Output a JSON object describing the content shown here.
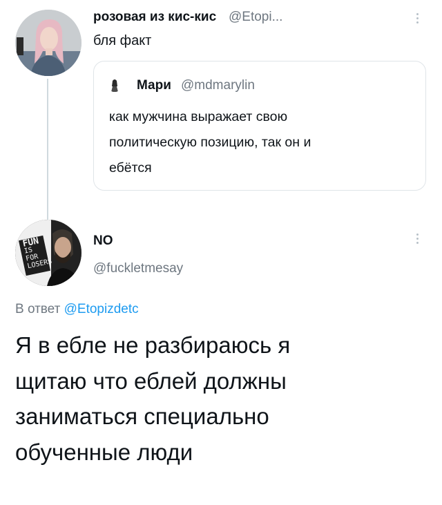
{
  "tweet1": {
    "display_name": "розовая из кис-кис",
    "handle": "@Etopi...",
    "text": "бля факт",
    "more_icon": "ellipsis-vertical-icon"
  },
  "quoted": {
    "display_name": "Мари",
    "handle": "@mdmarylin",
    "text_lines": [
      "как мужчина выражает свою",
      "политическую позицию, так он и",
      "ебётся"
    ]
  },
  "tweet2": {
    "display_name": "NO",
    "handle": "@fuckletmesay",
    "avatar_text": [
      "FUN",
      "IS FOR",
      "LOSERS"
    ],
    "reply_prefix": "В ответ",
    "reply_handle": "@Etopizdetc",
    "text_lines": [
      "Я в ебле не разбираюсь я",
      "щитаю что еблей должны",
      "заниматься специально",
      "обученные люди"
    ]
  },
  "colors": {
    "link": "#1d9bf0",
    "secondary": "#6e7780",
    "border": "#dfe4e8"
  }
}
